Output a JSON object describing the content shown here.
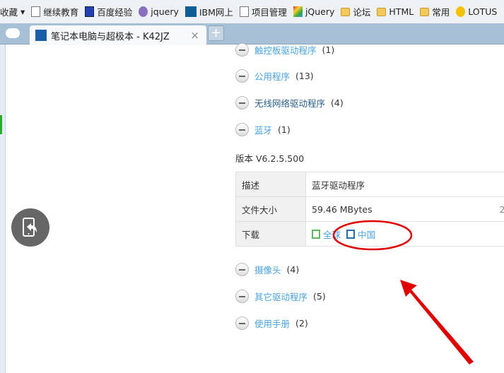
{
  "bookmarks": {
    "partial": "收藏",
    "items": [
      {
        "label": "继续教育",
        "icon": "page-icon"
      },
      {
        "label": "百度经验",
        "icon": "baidu-paw-icon"
      },
      {
        "label": "jquery",
        "icon": "php-icon"
      },
      {
        "label": "IBM网上",
        "icon": "ibm-icon"
      },
      {
        "label": "项目管理",
        "icon": "page-icon"
      },
      {
        "label": "jQuery",
        "icon": "jquery-icon"
      },
      {
        "label": "论坛",
        "icon": "folder-icon"
      },
      {
        "label": "HTML",
        "icon": "folder-icon"
      },
      {
        "label": "常用",
        "icon": "folder-icon"
      },
      {
        "label": "LOTUS",
        "icon": "lotus-icon"
      }
    ]
  },
  "tab": {
    "title": "笔记本电脑与超极本 - K42JZ",
    "close": "×",
    "new": "+"
  },
  "categories": [
    {
      "label": "触控板驱动程序",
      "count": "(1)"
    },
    {
      "label": "公用程序",
      "count": "(13)"
    },
    {
      "label": "无线网络驱动程序",
      "count": "(4)"
    },
    {
      "label": "蓝牙",
      "count": "(1)"
    }
  ],
  "version": "版本 V6.2.5.500",
  "details": {
    "desc_label": "描述",
    "desc_value": "蓝牙驱动程序",
    "size_label": "文件大小",
    "size_value": "59.46 MBytes",
    "size_extra": "2",
    "download_label": "下载",
    "global": "全球",
    "china": "中国"
  },
  "categories2": [
    {
      "label": "摄像头",
      "count": "(4)"
    },
    {
      "label": "其它驱动程序",
      "count": "(5)"
    },
    {
      "label": "使用手册",
      "count": "(2)"
    }
  ],
  "colors": {
    "link": "#4aa3df",
    "annotation": "#e00000"
  }
}
